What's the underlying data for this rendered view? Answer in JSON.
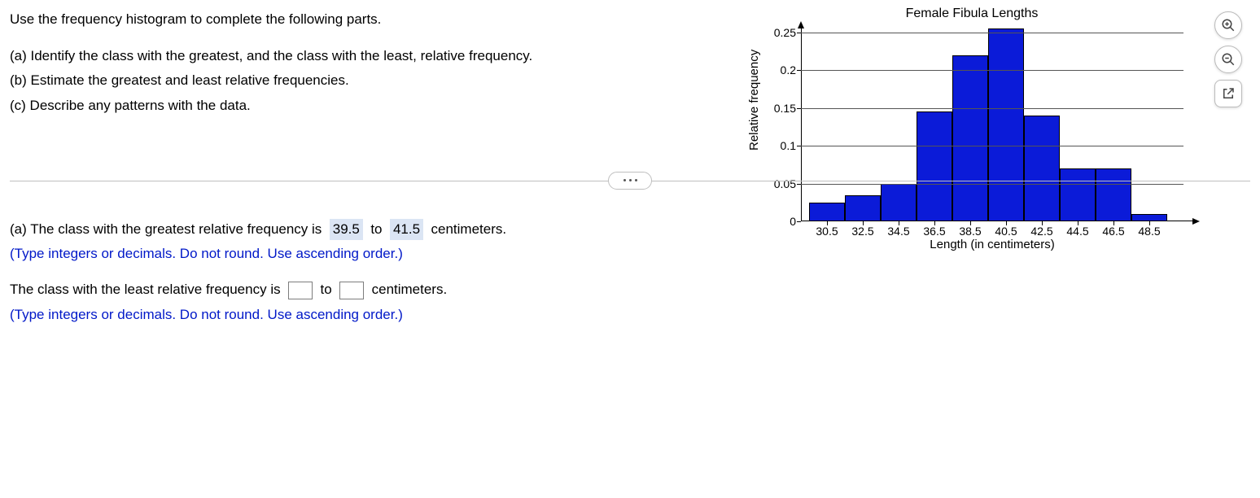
{
  "question": {
    "intro": "Use the frequency histogram to complete the following parts.",
    "a": "(a) Identify the class with the greatest, and the class with the least, relative frequency.",
    "b": "(b) Estimate the greatest and least relative frequencies.",
    "c": "(c) Describe any patterns with the data."
  },
  "chart_data": {
    "type": "bar",
    "title": "Female Fibula Lengths",
    "xlabel": "Length (in centimeters)",
    "ylabel": "Relative frequency",
    "ylim": [
      0,
      0.25
    ],
    "y_ticks": [
      0,
      0.05,
      0.1,
      0.15,
      0.2,
      0.25
    ],
    "x_tick_labels": [
      "30.5",
      "32.5",
      "34.5",
      "36.5",
      "38.5",
      "40.5",
      "42.5",
      "44.5",
      "46.5",
      "48.5"
    ],
    "categories": [
      "29.5-31.5",
      "31.5-33.5",
      "33.5-35.5",
      "35.5-37.5",
      "37.5-39.5",
      "39.5-41.5",
      "41.5-43.5",
      "43.5-45.5",
      "45.5-47.5",
      "47.5-49.5"
    ],
    "values": [
      0.025,
      0.035,
      0.05,
      0.145,
      0.22,
      0.255,
      0.14,
      0.07,
      0.07,
      0.01
    ]
  },
  "answers": {
    "a_greatest_prefix": "(a) The class with the greatest relative frequency is",
    "a_greatest_low": "39.5",
    "to": "to",
    "a_greatest_high": "41.5",
    "unit": "centimeters.",
    "hint": "(Type integers or decimals. Do not round. Use ascending order.)",
    "least_prefix": "The class with the least relative frequency is"
  },
  "tools": {
    "zoom_in": "zoom-in",
    "zoom_out": "zoom-out",
    "popout": "open-in-new"
  }
}
